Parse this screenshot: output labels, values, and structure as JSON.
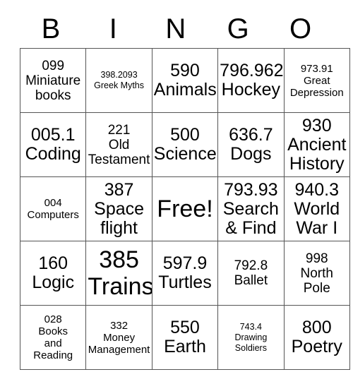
{
  "card": {
    "title_letters": [
      "B",
      "I",
      "N",
      "G",
      "O"
    ],
    "free_space_label": "Free!",
    "colors": {
      "background": "#ffffff",
      "text": "#000000",
      "grid_line": "#555555"
    },
    "columns": 5,
    "rows": 5,
    "cells": [
      [
        {
          "text": "099\nMiniature\nbooks",
          "size": "md"
        },
        {
          "text": "398.2093\nGreek Myths",
          "size": "xs"
        },
        {
          "text": "590\nAnimals",
          "size": "xl"
        },
        {
          "text": "796.962\nHockey",
          "size": "xl"
        },
        {
          "text": "973.91\nGreat\nDepression",
          "size": "sm"
        }
      ],
      [
        {
          "text": "005.1\nCoding",
          "size": "xl"
        },
        {
          "text": "221\nOld\nTestament",
          "size": "md"
        },
        {
          "text": "500\nScience",
          "size": "xl"
        },
        {
          "text": "636.7\nDogs",
          "size": "xl"
        },
        {
          "text": "930\nAncient\nHistory",
          "size": "xl"
        }
      ],
      [
        {
          "text": "004\nComputers",
          "size": "sm"
        },
        {
          "text": "387\nSpace\nflight",
          "size": "xl"
        },
        {
          "text": "Free!",
          "size": "xxl"
        },
        {
          "text": "793.93\nSearch\n& Find",
          "size": "xl"
        },
        {
          "text": "940.3\nWorld\nWar I",
          "size": "xl"
        }
      ],
      [
        {
          "text": "160\nLogic",
          "size": "xl"
        },
        {
          "text": "385\nTrains",
          "size": "xxl"
        },
        {
          "text": "597.9\nTurtles",
          "size": "xl"
        },
        {
          "text": "792.8\nBallet",
          "size": "md"
        },
        {
          "text": "998\nNorth\nPole",
          "size": "md"
        }
      ],
      [
        {
          "text": "028\nBooks\nand\nReading",
          "size": "sm"
        },
        {
          "text": "332\nMoney\nManagement",
          "size": "sm"
        },
        {
          "text": "550\nEarth",
          "size": "xl"
        },
        {
          "text": "743.4\nDrawing\nSoldiers",
          "size": "xs"
        },
        {
          "text": "800\nPoetry",
          "size": "xl"
        }
      ]
    ]
  }
}
